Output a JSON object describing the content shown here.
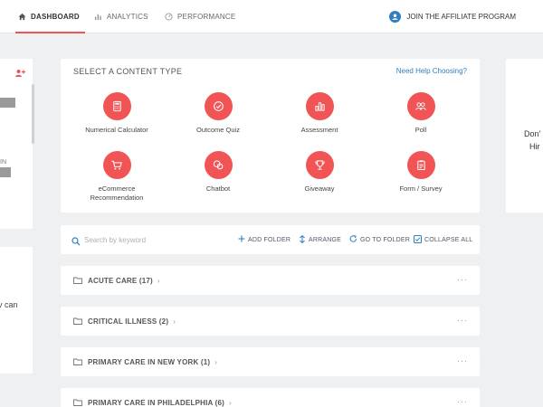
{
  "nav": {
    "tabs": [
      {
        "label": "DASHBOARD",
        "icon": "home-icon",
        "active": true
      },
      {
        "label": "ANALYTICS",
        "icon": "bar-chart-icon",
        "active": false
      },
      {
        "label": "PERFORMANCE",
        "icon": "gauge-icon",
        "active": false
      }
    ],
    "affiliate_label": "JOIN THE AFFILIATE PROGRAM"
  },
  "left_panel": {
    "snippet_in": "IN",
    "snippet_can": "v can"
  },
  "content_type": {
    "title": "SELECT A CONTENT TYPE",
    "help_link": "Need Help Choosing?",
    "items": [
      {
        "label": "Numerical Calculator",
        "icon": "calculator-icon"
      },
      {
        "label": "Outcome Quiz",
        "icon": "check-circle-icon"
      },
      {
        "label": "Assessment",
        "icon": "bar-chart-icon"
      },
      {
        "label": "Poll",
        "icon": "users-icon"
      },
      {
        "label": "eCommerce Recommendation",
        "icon": "cart-icon"
      },
      {
        "label": "Chatbot",
        "icon": "chat-icon"
      },
      {
        "label": "Giveaway",
        "icon": "trophy-icon"
      },
      {
        "label": "Form / Survey",
        "icon": "clipboard-icon"
      }
    ]
  },
  "right_panel": {
    "line1": "Don'",
    "line2": "Hir"
  },
  "toolbar": {
    "search_placeholder": "Search by keyword",
    "add_folder": "ADD FOLDER",
    "arrange": "ARRANGE",
    "go_to_folder": "GO TO FOLDER",
    "collapse_all": "COLLAPSE ALL"
  },
  "folders": [
    {
      "name": "ACUTE CARE (17)"
    },
    {
      "name": "CRITICAL ILLNESS (2)"
    },
    {
      "name": "PRIMARY CARE IN NEW YORK (1)"
    },
    {
      "name": "PRIMARY CARE IN PHILADELPHIA (6)"
    }
  ],
  "colors": {
    "accent": "#f05454",
    "link": "#2f7fc1",
    "background": "#eef0f2"
  }
}
